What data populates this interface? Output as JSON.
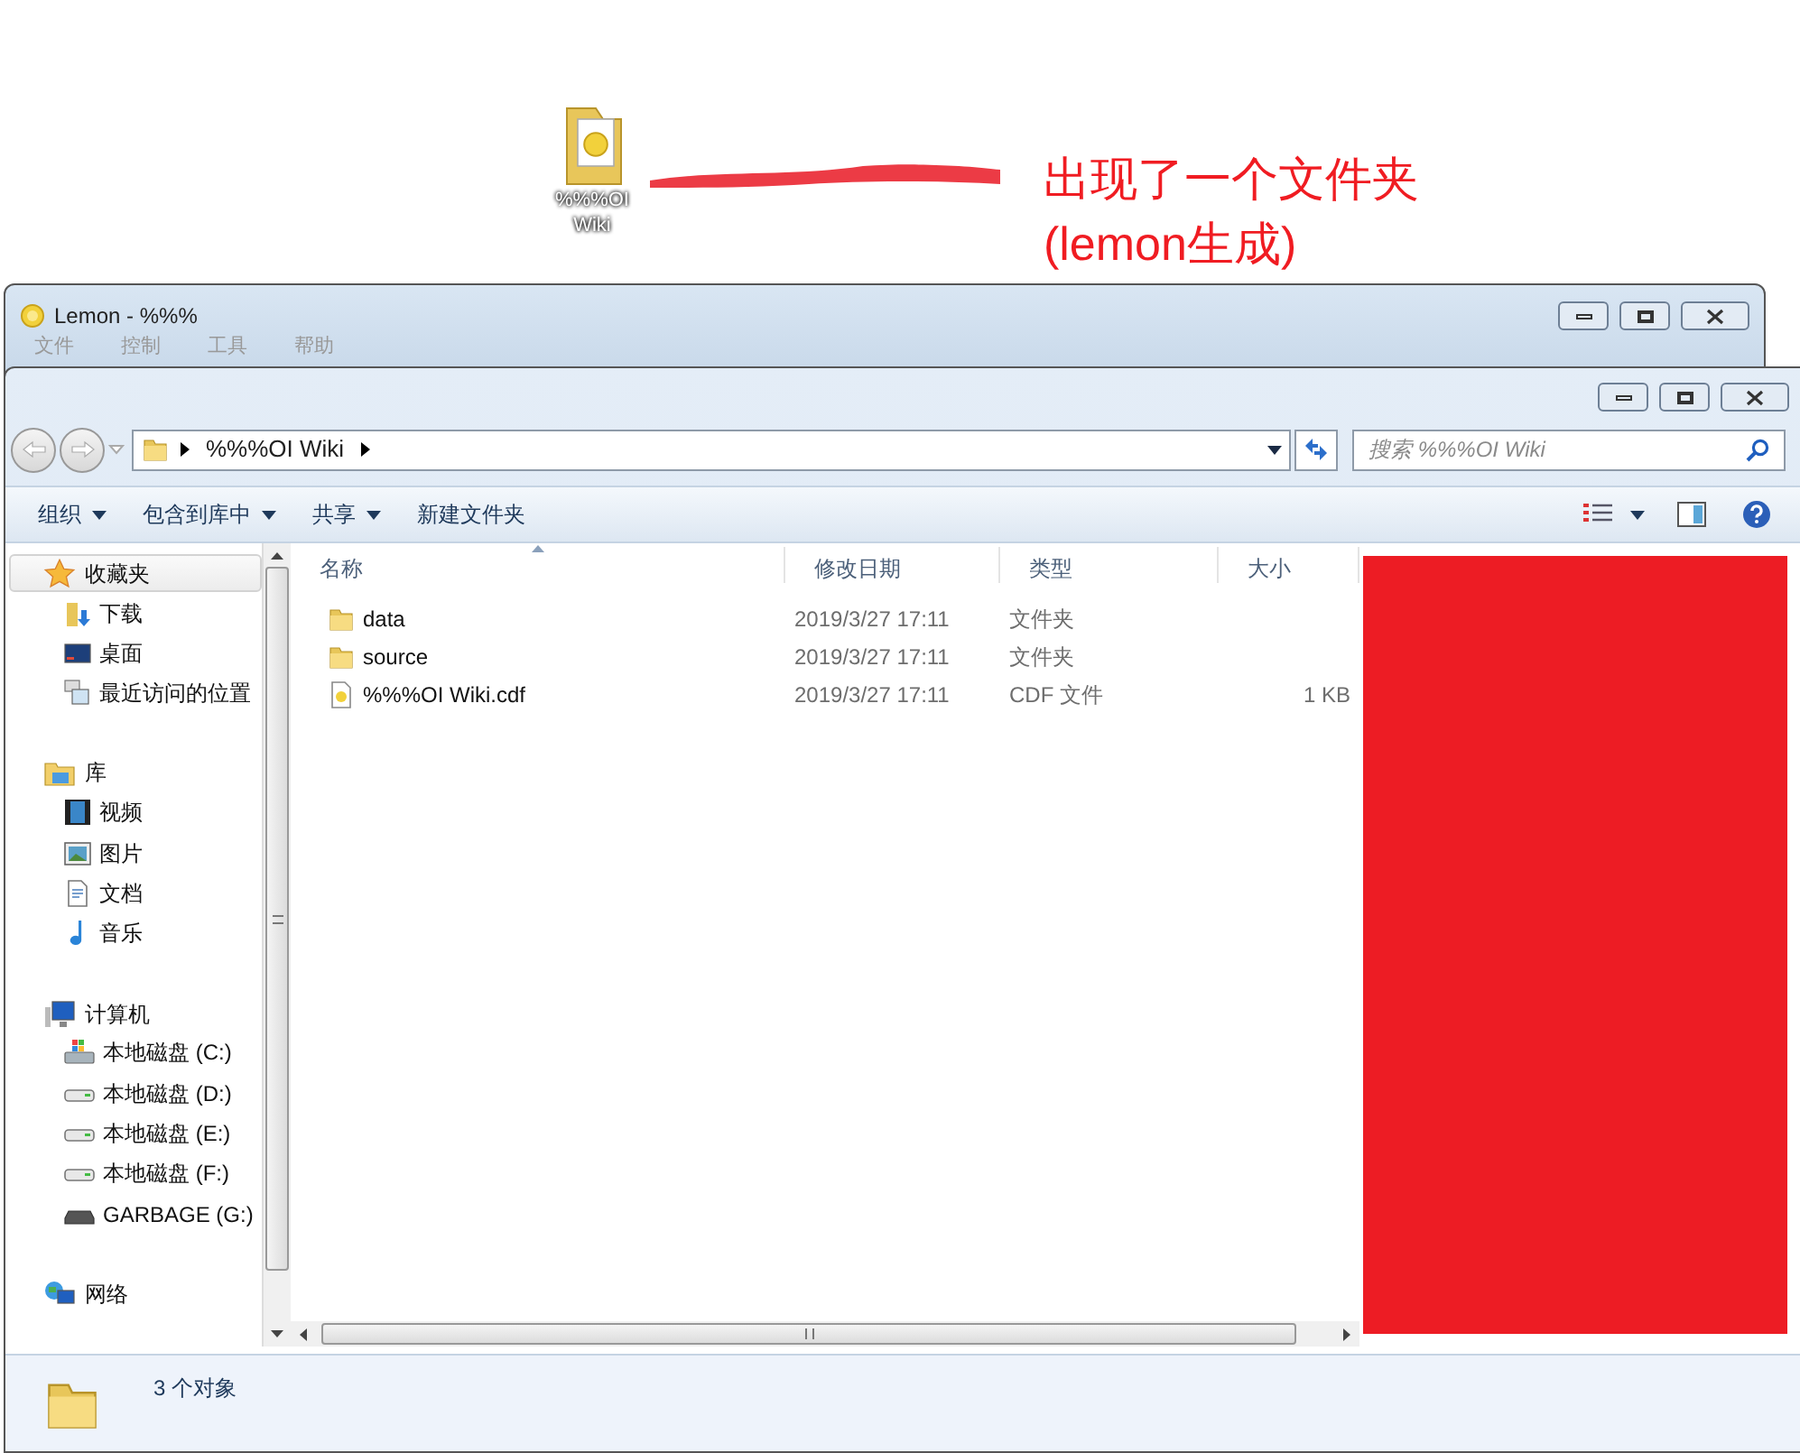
{
  "desktop_icon": {
    "label": "%%%OI Wiki"
  },
  "annotation": {
    "lines": [
      "出现了一个文件夹",
      "(lemon生成)"
    ]
  },
  "lemon_window": {
    "title": "Lemon - %%%",
    "menu": [
      "文件",
      "控制",
      "工具",
      "帮助"
    ]
  },
  "explorer": {
    "address": {
      "path": "%%%OI Wiki"
    },
    "search": {
      "placeholder": "搜索 %%%OI Wiki"
    },
    "toolbar": [
      {
        "label": "组织",
        "dropdown": true
      },
      {
        "label": "包含到库中",
        "dropdown": true
      },
      {
        "label": "共享",
        "dropdown": true
      },
      {
        "label": "新建文件夹",
        "dropdown": false
      }
    ],
    "sidebar": [
      {
        "label": "收藏夹",
        "kind": "star",
        "selected": true,
        "children": [
          {
            "label": "下载",
            "kind": "download",
            "selected": false
          },
          {
            "label": "桌面",
            "kind": "desktop",
            "selected": false
          },
          {
            "label": "最近访问的位置",
            "kind": "recent",
            "selected": false
          }
        ]
      },
      {
        "label": "库",
        "kind": "library",
        "selected": false,
        "children": [
          {
            "label": "视频",
            "kind": "video",
            "selected": false
          },
          {
            "label": "图片",
            "kind": "picture",
            "selected": false
          },
          {
            "label": "文档",
            "kind": "document",
            "selected": false
          },
          {
            "label": "音乐",
            "kind": "music",
            "selected": false
          }
        ]
      },
      {
        "label": "计算机",
        "kind": "computer",
        "selected": false,
        "children": [
          {
            "label": "本地磁盘 (C:)",
            "kind": "system-drive",
            "selected": false
          },
          {
            "label": "本地磁盘 (D:)",
            "kind": "drive",
            "selected": false
          },
          {
            "label": "本地磁盘 (E:)",
            "kind": "drive",
            "selected": false
          },
          {
            "label": "本地磁盘 (F:)",
            "kind": "drive",
            "selected": false
          },
          {
            "label": "GARBAGE (G:)",
            "kind": "removable",
            "selected": false
          }
        ]
      },
      {
        "label": "网络",
        "kind": "network",
        "selected": false
      }
    ],
    "columns": [
      {
        "label": "名称",
        "sorted": true
      },
      {
        "label": "修改日期",
        "sorted": false
      },
      {
        "label": "类型",
        "sorted": false
      },
      {
        "label": "大小",
        "sorted": false
      }
    ],
    "rows": [
      {
        "kind": "folder",
        "name": "data",
        "modified": "2019/3/27 17:11",
        "type": "文件夹"
      },
      {
        "kind": "folder",
        "name": "source",
        "modified": "2019/3/27 17:11",
        "type": "文件夹"
      },
      {
        "kind": "file",
        "name": "%%%OI Wiki.cdf",
        "modified": "2019/3/27 17:11",
        "type": "CDF 文件",
        "size": "1 KB"
      }
    ],
    "status": "3 个对象"
  }
}
